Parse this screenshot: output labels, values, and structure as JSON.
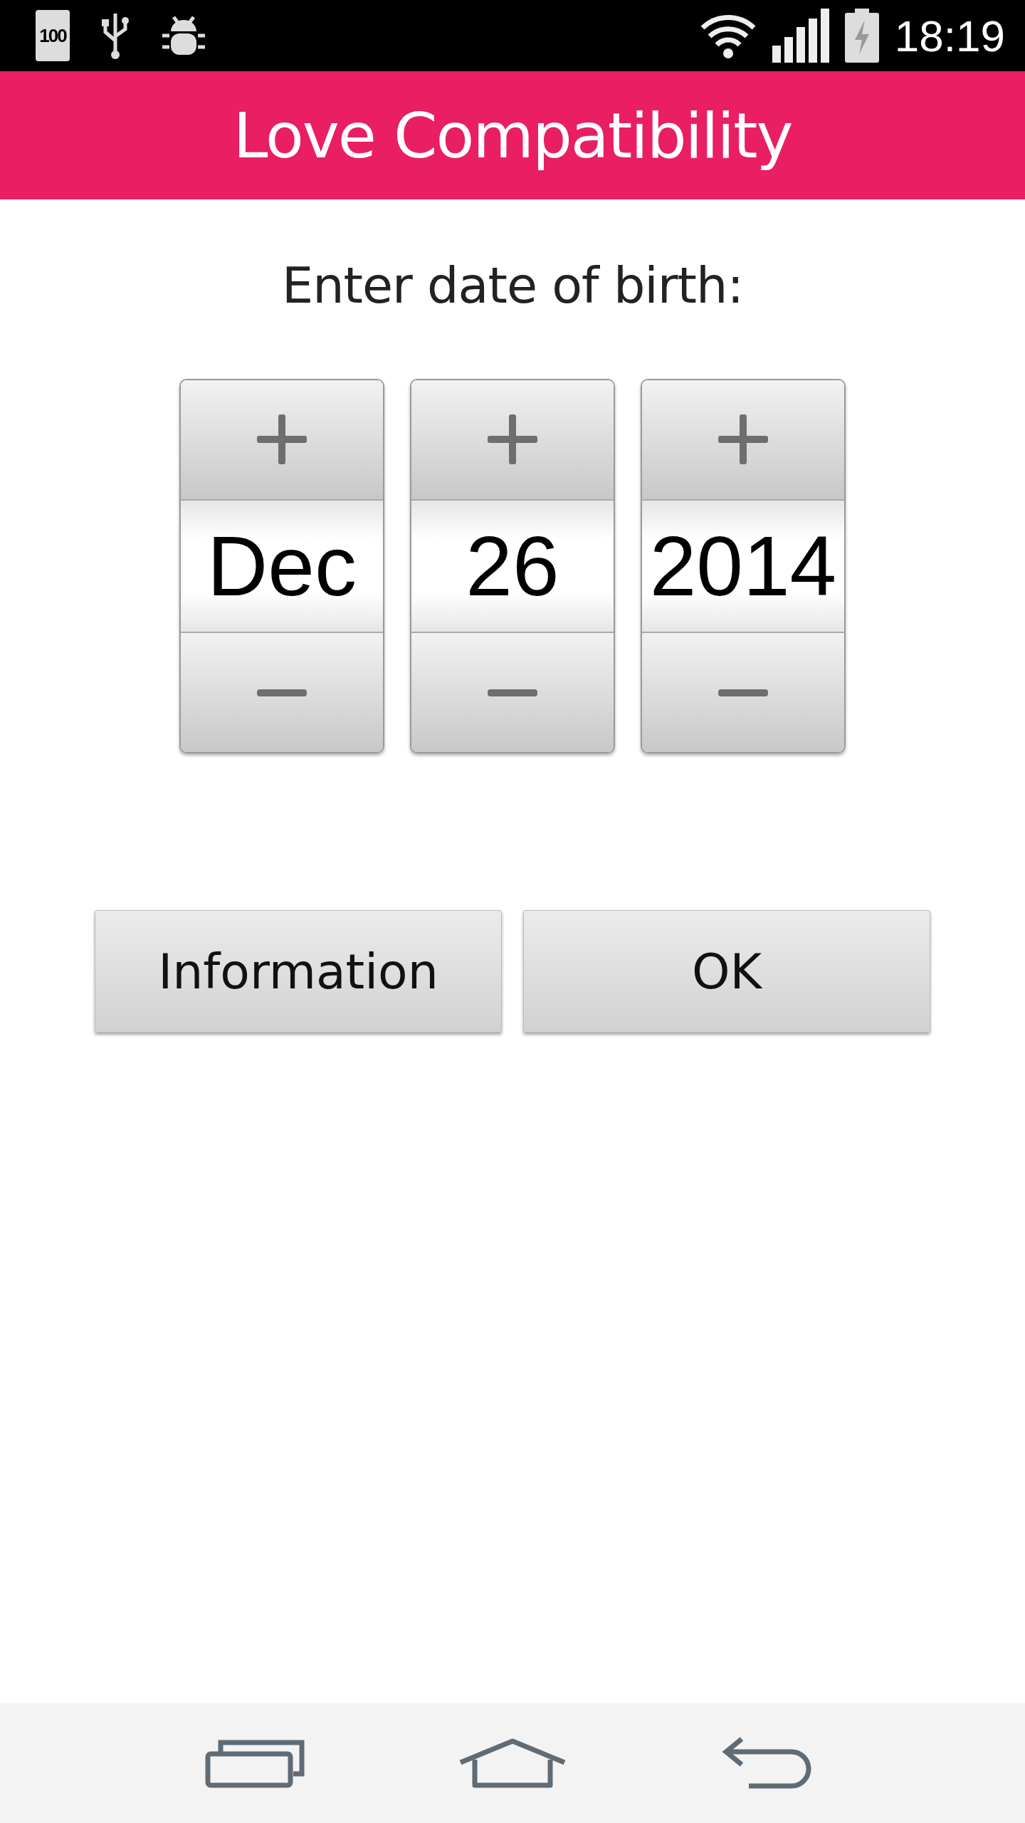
{
  "status_bar": {
    "battery_badge": "100",
    "time": "18:19"
  },
  "app_bar": {
    "title": "Love Compatibility"
  },
  "prompt": "Enter date of birth:",
  "date_spinners": [
    {
      "value": "Dec"
    },
    {
      "value": "26"
    },
    {
      "value": "2014"
    }
  ],
  "buttons": [
    "Information",
    "OK"
  ]
}
